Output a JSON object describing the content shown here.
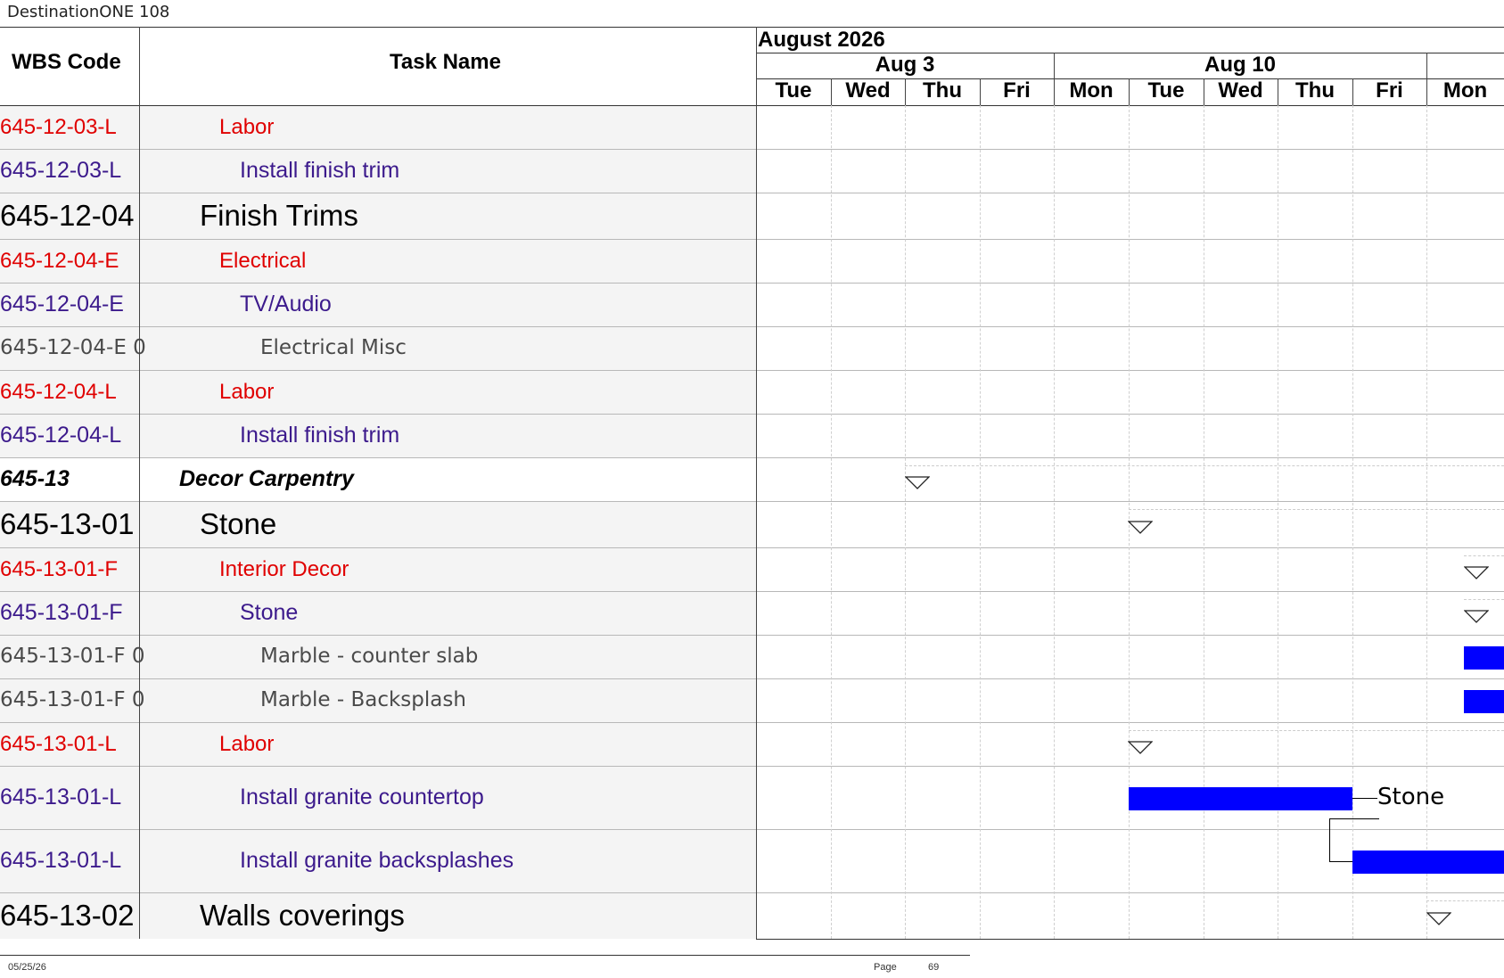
{
  "document": {
    "title": "DestinationONE 108"
  },
  "columns": {
    "wbs": "WBS Code",
    "task": "Task Name"
  },
  "calendar": {
    "month": "August 2026",
    "weeks": [
      "Aug 3",
      "Aug 10"
    ],
    "days": [
      "Tue",
      "Wed",
      "Thu",
      "Fri",
      "Mon",
      "Tue",
      "Wed",
      "Thu",
      "Fri",
      "Mon"
    ]
  },
  "rows": [
    {
      "wbs": "645-12-03-L",
      "task": "Labor",
      "style": "group-red"
    },
    {
      "wbs": "645-12-03-L",
      "task": "Install finish trim",
      "style": "item-purple"
    },
    {
      "wbs": "645-12-04",
      "task": "Finish Trims",
      "style": "section-large"
    },
    {
      "wbs": "645-12-04-E",
      "task": "Electrical",
      "style": "group-red"
    },
    {
      "wbs": "645-12-04-E",
      "task": "TV/Audio",
      "style": "item-purple"
    },
    {
      "wbs": "645-12-04-E 0",
      "task": "Electrical Misc",
      "style": "detail-gray"
    },
    {
      "wbs": "645-12-04-L",
      "task": "Labor",
      "style": "group-red"
    },
    {
      "wbs": "645-12-04-L",
      "task": "Install finish trim",
      "style": "item-purple"
    },
    {
      "wbs": "645-13",
      "task": "Decor Carpentry",
      "style": "summary-bold-italic"
    },
    {
      "wbs": "645-13-01",
      "task": "Stone",
      "style": "section-large"
    },
    {
      "wbs": "645-13-01-F",
      "task": "Interior Decor",
      "style": "group-red"
    },
    {
      "wbs": "645-13-01-F",
      "task": "Stone",
      "style": "item-purple"
    },
    {
      "wbs": "645-13-01-F 0",
      "task": "Marble - counter slab",
      "style": "detail-gray"
    },
    {
      "wbs": "645-13-01-F 0",
      "task": "Marble - Backsplash",
      "style": "detail-gray"
    },
    {
      "wbs": "645-13-01-L",
      "task": "Labor",
      "style": "group-red"
    },
    {
      "wbs": "645-13-01-L",
      "task": "Install granite countertop",
      "style": "item-purple"
    },
    {
      "wbs": "645-13-01-L",
      "task": "Install granite backsplashes",
      "style": "item-purple"
    },
    {
      "wbs": "645-13-02",
      "task": "Walls coverings",
      "style": "section-large"
    }
  ],
  "gantt": {
    "bar_label": "Stone",
    "bar_color": "#0000ff"
  },
  "colors": {
    "group_red": "#e00000",
    "item_purple": "#3c1a8c",
    "detail_gray": "#4a4a4a",
    "row_shade": "#f4f4f4"
  },
  "footer": {
    "date": "05/25/26",
    "page_label": "Page",
    "page_number": "69"
  }
}
